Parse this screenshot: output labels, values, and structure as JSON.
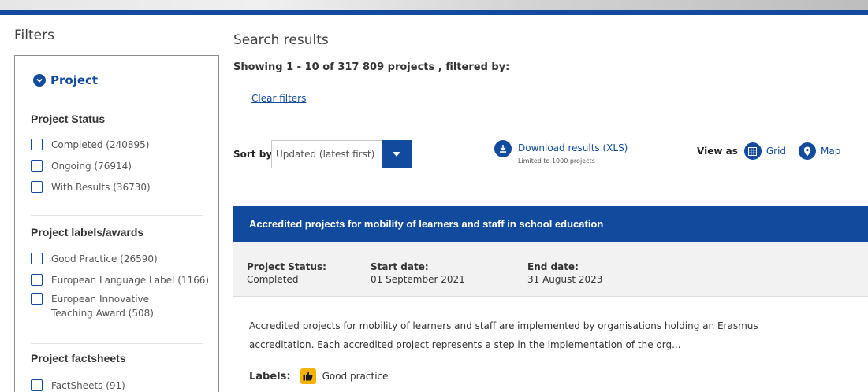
{
  "filters": {
    "title": "Filters",
    "section": "Project",
    "groups": {
      "status": {
        "title": "Project Status",
        "items": [
          "Completed (240895)",
          "Ongoing (76914)",
          "With Results (36730)"
        ]
      },
      "labels": {
        "title": "Project labels/awards",
        "items": [
          "Good Practice (26590)",
          "European Language Label (1166)",
          "European Innovative Teaching Award (508)"
        ]
      },
      "factsheets": {
        "title": "Project factsheets",
        "items": [
          "FactSheets (91)"
        ]
      }
    }
  },
  "results": {
    "title": "Search results",
    "showing": "Showing 1 - 10 of 317 809 projects , filtered by:",
    "clear_filters": "Clear filters"
  },
  "sort": {
    "label": "Sort by",
    "value": "Updated (latest first)"
  },
  "download": {
    "label": "Download results (XLS)",
    "note": "Limited to 1000 projects"
  },
  "view": {
    "label": "View as",
    "options": [
      "Grid",
      "Map"
    ]
  },
  "card": {
    "title": "Accredited projects for mobility of learners and staff in school education",
    "status_label": "Project Status:",
    "status_value": "Completed",
    "start_label": "Start date:",
    "start_value": "01 September 2021",
    "end_label": "End date:",
    "end_value": "31 August 2023",
    "description": "Accredited projects for mobility of learners and staff are implemented by organisations holding an Erasmus accreditation. Each accredited project represents a step in the implementation of the org...",
    "labels_label": "Labels:",
    "label_value": "Good practice"
  },
  "colors": {
    "primary": "#124b9d",
    "badge": "#f5b300"
  }
}
